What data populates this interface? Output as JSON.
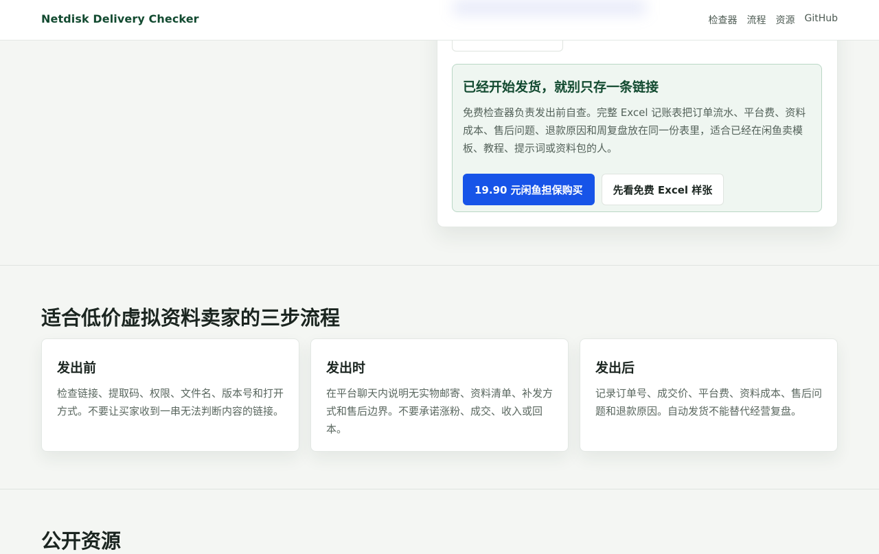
{
  "header": {
    "brand": "Netdisk Delivery Checker",
    "nav": [
      "检查器",
      "流程",
      "资源",
      "GitHub"
    ]
  },
  "promo": {
    "title": "已经开始发货，就别只存一条链接",
    "description": "免费检查器负责发出前自查。完整 Excel 记账表把订单流水、平台费、资料成本、售后问题、退款原因和周复盘放在同一份表里，适合已经在闲鱼卖模板、教程、提示词或资料包的人。",
    "primary_button": "19.90 元闲鱼担保购买",
    "secondary_button": "先看免费 Excel 样张"
  },
  "workflow": {
    "title": "适合低价虚拟资料卖家的三步流程",
    "steps": [
      {
        "title": "发出前",
        "text": "检查链接、提取码、权限、文件名、版本号和打开方式。不要让买家收到一串无法判断内容的链接。"
      },
      {
        "title": "发出时",
        "text": "在平台聊天内说明无实物邮寄、资料清单、补发方式和售后边界。不要承诺涨粉、成交、收入或回本。"
      },
      {
        "title": "发出后",
        "text": "记录订单号、成交价、平台费、资料成本、售后问题和退款原因。自动发货不能替代经营复盘。"
      }
    ]
  },
  "resources": {
    "title": "公开资源"
  },
  "colors": {
    "brand": "#124a30",
    "primary": "#1754e8",
    "promo_bg": "#eff6f1",
    "page_bg": "#f4f6f3"
  }
}
